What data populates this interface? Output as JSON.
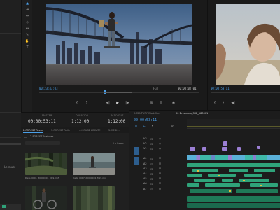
{
  "colors": {
    "accent": "#4a9fe8",
    "timecode_blue": "#4a9fe8",
    "clip_green": "#2fa37a",
    "clip_purple": "#9b7fd4",
    "clip_teal": "#3fb8a8",
    "audio_dark": "#1f7a58"
  },
  "left_panel": {
    "tool_icons": [
      "selection-tool-icon",
      "track-select-icon",
      "ripple-edit-icon",
      "razor-icon",
      "slip-icon",
      "pen-icon",
      "hand-icon",
      "type-icon"
    ]
  },
  "source_monitor": {
    "timecode_in": "00:23:43:03",
    "timecode_out": "00:00:02:01",
    "fit_label": "Full"
  },
  "program_monitor": {
    "timecode": "00:00:53:11"
  },
  "info_strip": {
    "master_label": "MASTER",
    "master_value": "00:00:53:11",
    "duration_label": "DURATION",
    "duration_value": "1:12:00",
    "in_out_label": "IN TO OUT",
    "in_out_value": "1:12:00"
  },
  "project_panel": {
    "tabs": [
      "2-FOREST Reels",
      "3-FOREST Rolls",
      "4-HOUSE LOCATE",
      "5-MEDI..."
    ],
    "bin_path": "2-FOREST Features",
    "count_label": "Le Items",
    "thumbnails": [
      {
        "label": "Dads_0001_30000001_Mk9.mxf"
      },
      {
        "label": "Dads_0017_20000001_Mk9.mxf"
      },
      {
        "label": ""
      },
      {
        "label": ""
      }
    ]
  },
  "timeline": {
    "tabs": [
      "A CENTURY Work files",
      "00 Dreamers_S3E_180001"
    ],
    "timecode": "00:00:53:11",
    "track_labels": [
      "V3",
      "V2",
      "V1",
      "A1",
      "A2",
      "A3",
      "A4",
      "A5",
      "A6",
      "A7"
    ],
    "side_label": "Le mute"
  }
}
